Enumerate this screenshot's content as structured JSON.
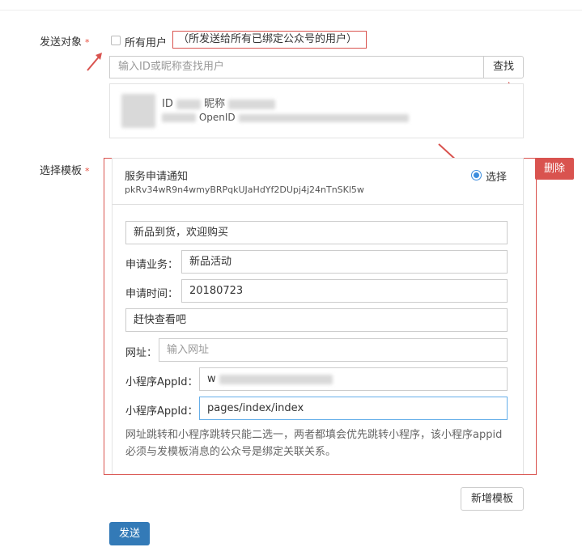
{
  "form": {
    "send_target_label": "发送对象",
    "required_mark": "*",
    "all_users_label": "所有用户",
    "all_users_hint": "（所发送给所有已绑定公众号的用户）",
    "search_placeholder": "输入ID或昵称查找用户",
    "search_button": "查找",
    "user_card": {
      "id_label": "ID",
      "nickname_label": "昵称",
      "openid_label": "OpenID"
    },
    "template_label": "选择模板",
    "delete_button": "删除",
    "add_template_button": "新增模板",
    "send_button": "发送"
  },
  "template": {
    "name": "服务申请通知",
    "template_id": "pkRv34wR9n4wmyBRPqkUJaHdYf2DUpj4j24nTnSKl5w",
    "select_label": "选择",
    "first_value": "新品到货，欢迎购买",
    "business_label": "申请业务：",
    "business_value": "新品活动",
    "time_label": "申请时间：",
    "time_value": "20180723",
    "remark_value": "赶快查看吧",
    "url_label": "网址：",
    "url_placeholder": "输入网址",
    "appid_label": "小程序AppId：",
    "appid_value_prefix": "w",
    "page_label": "小程序AppId：",
    "page_value": "pages/index/index",
    "note": "网址跳转和小程序跳转只能二选一，两者都填会优先跳转小程序，该小程序appid必须与发模板消息的公众号是绑定关联关系。"
  },
  "colors": {
    "annotation_red": "#d9534f",
    "primary": "#337ab7",
    "radio_blue": "#3c8dde"
  }
}
